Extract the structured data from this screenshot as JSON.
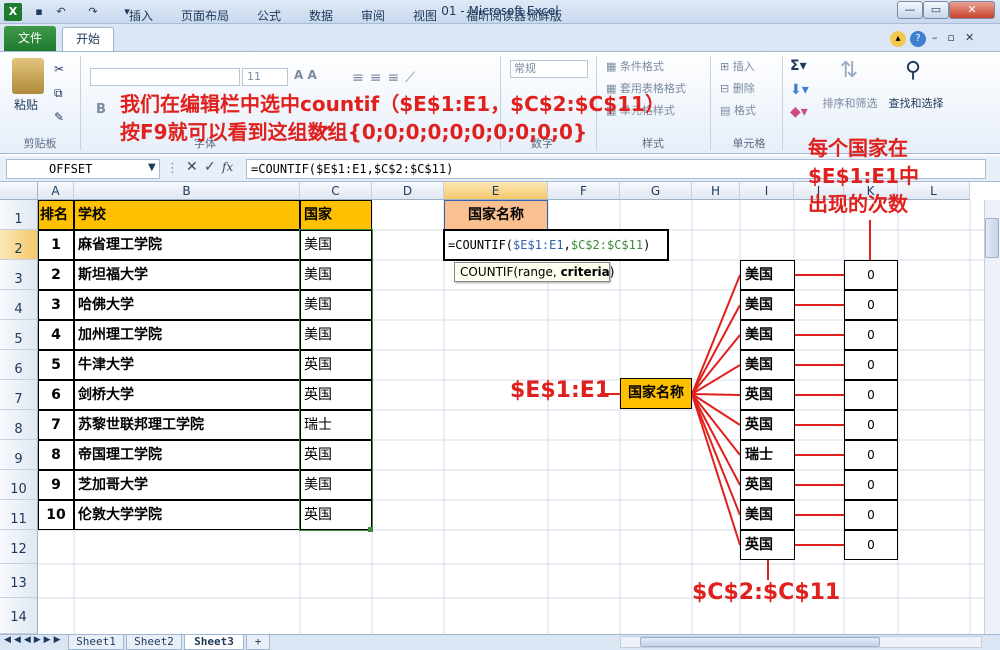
{
  "window": {
    "title": "01 - Microsoft Excel"
  },
  "tabs": {
    "file": "文件",
    "items": [
      "开始",
      "插入",
      "页面布局",
      "公式",
      "数据",
      "审阅",
      "视图",
      "福昕阅读器领鲜版"
    ]
  },
  "ribbon": {
    "paste": "粘贴",
    "clipboard": "剪贴板",
    "font_size": "11",
    "font_group": "字体",
    "number_format": "常规",
    "number_group": "数字",
    "cond_format": "条件格式",
    "table_format": "套用表格格式",
    "cell_style": "单元格样式",
    "style_group": "样式",
    "insert": "插入",
    "delete": "删除",
    "format": "格式",
    "cells_group": "单元格",
    "sort_filter": "排序和筛选",
    "find_select": "查找和选择"
  },
  "formula_bar": {
    "name_box": "OFFSET",
    "formula": "=COUNTIF($E$1:E1,$C$2:$C$11)"
  },
  "columns": [
    "A",
    "B",
    "C",
    "D",
    "E",
    "F",
    "G",
    "H",
    "I",
    "J",
    "K",
    "L"
  ],
  "rows": [
    "1",
    "2",
    "3",
    "4",
    "5",
    "6",
    "7",
    "8",
    "9",
    "10",
    "11",
    "12",
    "13",
    "14"
  ],
  "table": {
    "headers": [
      "排名",
      "学校",
      "国家"
    ],
    "rows": [
      {
        "rank": "1",
        "school": "麻省理工学院",
        "country": "美国"
      },
      {
        "rank": "2",
        "school": "斯坦福大学",
        "country": "美国"
      },
      {
        "rank": "3",
        "school": "哈佛大学",
        "country": "美国"
      },
      {
        "rank": "4",
        "school": "加州理工学院",
        "country": "美国"
      },
      {
        "rank": "5",
        "school": "牛津大学",
        "country": "英国"
      },
      {
        "rank": "6",
        "school": "剑桥大学",
        "country": "英国"
      },
      {
        "rank": "7",
        "school": "苏黎世联邦理工学院",
        "country": "瑞士"
      },
      {
        "rank": "8",
        "school": "帝国理工学院",
        "country": "英国"
      },
      {
        "rank": "9",
        "school": "芝加哥大学",
        "country": "美国"
      },
      {
        "rank": "10",
        "school": "伦敦大学学院",
        "country": "英国"
      }
    ]
  },
  "e1_header": "国家名称",
  "editing_cell": {
    "prefix": "=COUNTIF(",
    "arg1": "$E$1:E1",
    "comma": ",",
    "arg2": "$C$2:$C$11",
    "suffix": ")"
  },
  "tooltip": {
    "fn": "COUNTIF(range, ",
    "arg": "criteria",
    "end": ")"
  },
  "annotations": {
    "top_line1": "我们在编辑栏中选中countif（$E$1:E1，$C$2:$C$11）",
    "top_line2": "按F9就可以看到这组数组{0;0;0;0;0;0;0;0;0;0}",
    "right_line1": "每个国家在",
    "right_line2": "$E$1:E1中",
    "right_line3": "出现的次数",
    "left_label": "$E$1:E1",
    "center_box": "国家名称",
    "bottom_label": "$C$2:$C$11"
  },
  "diagram": {
    "countries": [
      "美国",
      "美国",
      "美国",
      "美国",
      "英国",
      "英国",
      "瑞士",
      "英国",
      "美国",
      "英国"
    ],
    "counts": [
      "0",
      "0",
      "0",
      "0",
      "0",
      "0",
      "0",
      "0",
      "0",
      "0"
    ]
  },
  "sheets": [
    "Sheet1",
    "Sheet2",
    "Sheet3"
  ],
  "colors": {
    "header_fill": "#ffc000",
    "e1_fill": "#fac090",
    "annotation": "#e0201c",
    "excel_green": "#1e7a2e"
  }
}
